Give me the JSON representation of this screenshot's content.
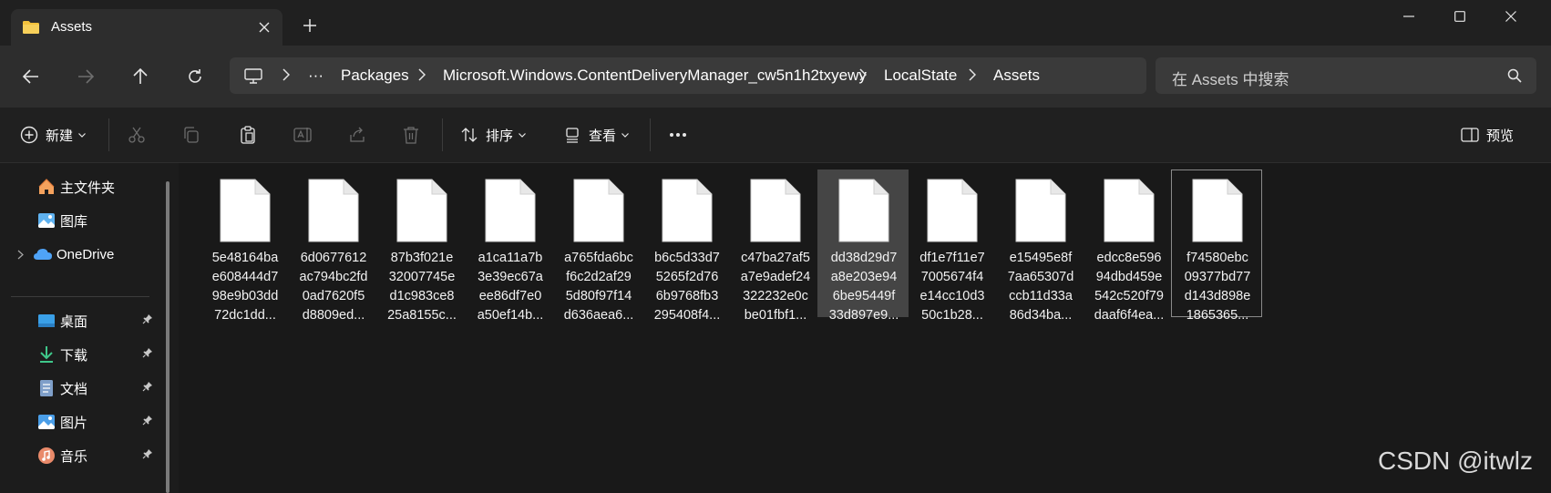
{
  "window": {
    "tab_title": "Assets"
  },
  "navigation": {
    "breadcrumbs": [
      "Packages",
      "Microsoft.Windows.ContentDeliveryManager_cw5n1h2txyewy",
      "LocalState",
      "Assets"
    ],
    "overflow": "···",
    "search_placeholder": "在 Assets 中搜索"
  },
  "toolbar": {
    "new_label": "新建",
    "sort_label": "排序",
    "view_label": "查看",
    "more_label": "···",
    "preview_label": "预览"
  },
  "sidebar": {
    "top_items": [
      {
        "label": "主文件夹",
        "icon": "home-icon"
      },
      {
        "label": "图库",
        "icon": "gallery-icon"
      },
      {
        "label": "OneDrive",
        "icon": "cloud-icon"
      }
    ],
    "pinned_items": [
      {
        "label": "桌面",
        "icon": "desktop-icon"
      },
      {
        "label": "下载",
        "icon": "download-icon"
      },
      {
        "label": "文档",
        "icon": "document-icon"
      },
      {
        "label": "图片",
        "icon": "pictures-icon"
      },
      {
        "label": "音乐",
        "icon": "music-icon"
      }
    ]
  },
  "files": [
    {
      "name": "5e48164ba\ne608444d7\n98e9b03dd\n72dc1dd..."
    },
    {
      "name": "6d0677612\nac794bc2fd\n0ad7620f5\nd8809ed..."
    },
    {
      "name": "87b3f021e\n32007745e\nd1c983ce8\n25a8155c..."
    },
    {
      "name": "a1ca11a7b\n3e39ec67a\nee86df7e0\na50ef14b..."
    },
    {
      "name": "a765fda6bc\nf6c2d2af29\n5d80f97f14\nd636aea6..."
    },
    {
      "name": "b6c5d33d7\n5265f2d76\n6b9768fb3\n295408f4..."
    },
    {
      "name": "c47ba27af5\na7e9adef24\n322232e0c\nbe01fbf1..."
    },
    {
      "name": "dd38d29d7\na8e203e94\n6be95449f\n33d897e9..."
    },
    {
      "name": "df1e7f11e7\n7005674f4\ne14cc10d3\n50c1b28..."
    },
    {
      "name": "e15495e8f\n7aa65307d\nccb11d33a\n86d34ba..."
    },
    {
      "name": "edcc8e596\n94dbd459e\n542c520f79\ndaaf6f4ea..."
    },
    {
      "name": "f74580ebc\n09377bd77\nd143d898e\n1865365..."
    }
  ],
  "watermark": "CSDN @itwlz",
  "colors": {
    "titlebar": "#202020",
    "address_row": "#2d2d2d",
    "content_bg": "#191919",
    "hover_bg": "#454545",
    "onedrive_blue": "#4fa3f7",
    "folder_yellow": "#f3c23c"
  }
}
